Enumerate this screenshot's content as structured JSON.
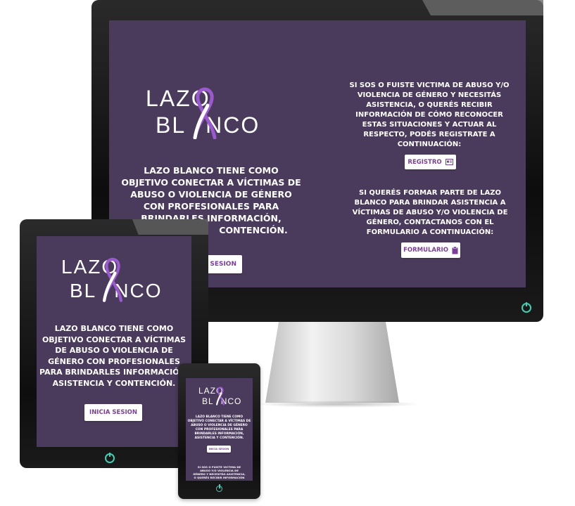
{
  "brand": {
    "logo_line1": "LAZO",
    "logo_line2": "BL",
    "logo_line2_end": "NCO",
    "logo_ribbon_color": "#9b59d0"
  },
  "colors": {
    "screen_bg": "#4a3a5c",
    "accent": "#7b3f9a",
    "power": "#3fd0b5"
  },
  "intro": {
    "text": "LAZO BLANCO TIENE COMO OBJETIVO CONECTAR A VÍCTIMAS DE ABUSO O VIOLENCIA DE GÉNERO CON PROFESIONALES PARA BRINDARLES INFORMACIÓN, ASISTENCIA Y CONTENCIÓN."
  },
  "intro_desktop_visible": {
    "l1": "LAZO BLANCO TIENE COMO",
    "l2": "OBJETIVO CONECTAR A VÍCTIMAS DE",
    "l3": "ABUSO O VIOLENCIA DE GÉNERO",
    "l4": "CON PROFESIONALES PARA",
    "l5": "BRINDARLES INFORMACIÓN,",
    "l6": "CONTENCIÓN."
  },
  "login": {
    "label": "INICIA SESION",
    "desktop_partial": "SESION"
  },
  "victims": {
    "text": "SI SOS O FUISTE VICTIMA DE ABUSO Y/O VIOLENCIA DE GÉNERO Y NECESITÁS ASISTENCIA, O QUERÉS RECIBIR INFORMACIÓN DE CÓMO RECONOCER ESTAS SITUACIONES Y ACTUAR AL RESPECTO, PODÉS REGISTRATE A CONTINUACIÓN:",
    "button": "REGISTRO"
  },
  "pros": {
    "text_before": "SI QUERÉS FORMAR PARTE DE ",
    "brand": "LAZO BLANCO",
    "text_after": " PARA BRINDAR ASISTENCIA A VÍCTIMAS DE ABUSO Y/O VIOLENCIA DE GÉNERO, CONTACTANOS CON EL FORMULARIO A CONTINUACIÓN:",
    "button": "FORMULARIO"
  },
  "phone_victims": {
    "l1": "SI SOS O FUISTE VICTIMA DE",
    "l2": "ABUSO Y/O VIOLENCIA DE",
    "l3": "GÉNERO Y NECESITÁS ASISTENCIA,",
    "l4": "O QUERÉS RECIBIR INFORMACIÓN"
  },
  "icons": {
    "registro": "id-card-icon",
    "formulario": "clipboard-icon",
    "power": "power-icon"
  }
}
